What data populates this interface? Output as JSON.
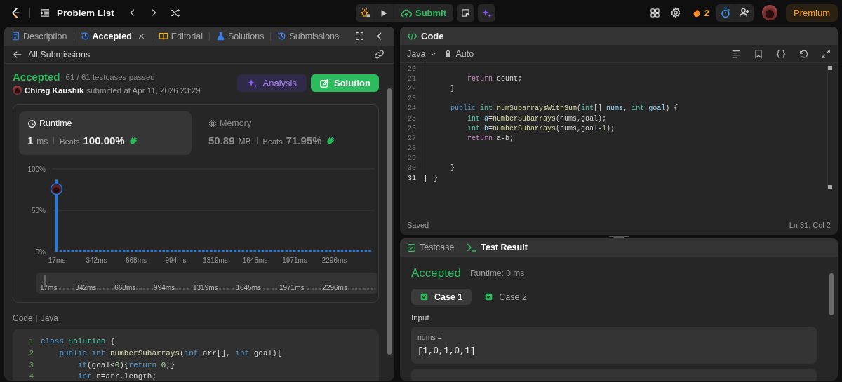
{
  "topbar": {
    "problem_list": "Problem List",
    "submit": "Submit",
    "streak": "2",
    "premium": "Premium"
  },
  "tabs": [
    {
      "label": "Description",
      "kind": "description",
      "selected": false,
      "closable": false
    },
    {
      "label": "Accepted",
      "kind": "result",
      "selected": true,
      "closable": true
    },
    {
      "label": "Editorial",
      "kind": "editorial",
      "selected": false,
      "closable": false
    },
    {
      "label": "Solutions",
      "kind": "solutions",
      "selected": false,
      "closable": false
    },
    {
      "label": "Submissions",
      "kind": "submissions",
      "selected": false,
      "closable": false
    }
  ],
  "submission": {
    "back": "All Submissions",
    "status": "Accepted",
    "passed": "61 / 61 testcases passed",
    "author": "Chirag Kaushik",
    "submitted": "submitted at Apr 11, 2026 23:29",
    "buttons": [
      {
        "label": "Analysis",
        "kind": "analysis"
      },
      {
        "label": "Solution",
        "kind": "solution"
      }
    ]
  },
  "metrics": [
    {
      "kind": "runtime",
      "label": "Runtime",
      "value": "1",
      "unit": "ms",
      "beats_label": "Beats",
      "beats": "100.00%",
      "selected": true
    },
    {
      "kind": "memory",
      "label": "Memory",
      "value": "50.89",
      "unit": "MB",
      "beats_label": "Beats",
      "beats": "71.95%",
      "selected": false
    }
  ],
  "chart_data": {
    "type": "bar",
    "ylim": [
      0,
      100
    ],
    "yticks": [
      {
        "value": 0,
        "label": "0%"
      },
      {
        "value": 50,
        "label": "50%"
      },
      {
        "value": 100,
        "label": "100%"
      }
    ],
    "categories": [
      "17ms",
      null,
      null,
      null,
      null,
      null,
      null,
      null,
      null,
      null,
      "342ms",
      null,
      null,
      null,
      null,
      null,
      null,
      null,
      null,
      null,
      "668ms",
      null,
      null,
      null,
      null,
      null,
      null,
      null,
      null,
      null,
      "994ms",
      null,
      null,
      null,
      null,
      null,
      null,
      null,
      null,
      null,
      "1319ms",
      null,
      null,
      null,
      null,
      null,
      null,
      null,
      null,
      null,
      "1645ms",
      null,
      null,
      null,
      null,
      null,
      null,
      null,
      null,
      null,
      "1971ms",
      null,
      null,
      null,
      null,
      null,
      null,
      null,
      null,
      null,
      "2296ms",
      null,
      null,
      null,
      null,
      null,
      null,
      null,
      null,
      null
    ],
    "values": [
      87,
      2,
      2,
      2,
      2,
      2,
      2,
      2,
      2,
      2,
      2,
      2,
      2,
      2,
      2,
      2,
      2,
      2,
      2,
      2,
      2,
      2,
      2,
      2,
      2,
      2,
      2,
      2,
      2,
      2,
      2,
      2,
      2,
      2,
      2,
      2,
      2,
      2,
      2,
      2,
      2,
      2,
      2,
      2,
      2,
      2,
      2,
      2,
      2,
      2,
      2,
      2,
      2,
      2,
      2,
      2,
      2,
      2,
      2,
      2,
      2,
      2,
      2,
      2,
      2,
      2,
      2,
      2,
      2,
      2,
      2,
      2,
      2,
      2,
      2,
      2,
      2,
      2,
      2,
      2
    ]
  },
  "navigator_labels": [
    "17ms",
    "342ms",
    "668ms",
    "994ms",
    "1319ms",
    "1645ms",
    "1971ms",
    "2296ms"
  ],
  "code_section": {
    "label": "Code",
    "language": "Java",
    "lines": [
      {
        "number": "1",
        "tokens": [
          {
            "kind": "kw",
            "text": "class"
          },
          {
            "kind": "type",
            "text": " Solution"
          },
          {
            "kind": "plain",
            "text": " {"
          }
        ]
      },
      {
        "number": "2",
        "tokens": [
          {
            "kind": "kw",
            "text": "    public"
          },
          {
            "kind": "kw",
            "text": " int"
          },
          {
            "kind": "fn",
            "text": " numberSubarrays"
          },
          {
            "kind": "plain",
            "text": "("
          },
          {
            "kind": "kw",
            "text": "int"
          },
          {
            "kind": "plain",
            "text": " arr[], "
          },
          {
            "kind": "kw",
            "text": "int"
          },
          {
            "kind": "plain",
            "text": " goal){"
          }
        ]
      },
      {
        "number": "3",
        "tokens": [
          {
            "kind": "kw",
            "text": "        if"
          },
          {
            "kind": "plain",
            "text": "(goal<"
          },
          {
            "kind": "num",
            "text": "0"
          },
          {
            "kind": "plain",
            "text": "){"
          },
          {
            "kind": "kw",
            "text": "return"
          },
          {
            "kind": "num",
            "text": " 0"
          },
          {
            "kind": "plain",
            "text": ";}"
          }
        ]
      },
      {
        "number": "4",
        "tokens": [
          {
            "kind": "kw",
            "text": "        int"
          },
          {
            "kind": "plain",
            "text": " n=arr.length;"
          }
        ]
      }
    ]
  },
  "editor": {
    "title": "Code",
    "language": "Java",
    "mode": "Auto",
    "status": "Saved",
    "cursor": "Ln 31, Col 2",
    "lines": [
      {
        "number": "20",
        "active": false
      },
      {
        "number": "21",
        "active": false,
        "tokens": [
          {
            "kind": "ctrl",
            "text": "        return"
          },
          {
            "kind": "plain",
            "text": " count;"
          }
        ]
      },
      {
        "number": "22",
        "active": false,
        "tokens": [
          {
            "kind": "plain",
            "text": "    }"
          }
        ]
      },
      {
        "number": "23",
        "active": false
      },
      {
        "number": "24",
        "active": false,
        "tokens": [
          {
            "kind": "kw",
            "text": "    public"
          },
          {
            "kind": "type",
            "text": " int"
          },
          {
            "kind": "fn",
            "text": " numSubarraysWithSum"
          },
          {
            "kind": "plain",
            "text": "("
          },
          {
            "kind": "type",
            "text": "int"
          },
          {
            "kind": "plain",
            "text": "[] "
          },
          {
            "kind": "var",
            "text": "nums"
          },
          {
            "kind": "plain",
            "text": ", "
          },
          {
            "kind": "type",
            "text": "int"
          },
          {
            "kind": "var",
            "text": " goal"
          },
          {
            "kind": "plain",
            "text": ") {"
          }
        ]
      },
      {
        "number": "25",
        "active": false,
        "tokens": [
          {
            "kind": "type",
            "text": "        int"
          },
          {
            "kind": "var",
            "text": " a"
          },
          {
            "kind": "plain",
            "text": "="
          },
          {
            "kind": "fn",
            "text": "numberSubarrays"
          },
          {
            "kind": "plain",
            "text": "(nums,goal);"
          }
        ]
      },
      {
        "number": "26",
        "active": false,
        "tokens": [
          {
            "kind": "type",
            "text": "        int"
          },
          {
            "kind": "var",
            "text": " b"
          },
          {
            "kind": "plain",
            "text": "="
          },
          {
            "kind": "fn",
            "text": "numberSubarrays"
          },
          {
            "kind": "plain",
            "text": "(nums,goal-"
          },
          {
            "kind": "num",
            "text": "1"
          },
          {
            "kind": "plain",
            "text": ");"
          }
        ]
      },
      {
        "number": "27",
        "active": false,
        "tokens": [
          {
            "kind": "ctrl",
            "text": "        return"
          },
          {
            "kind": "plain",
            "text": " a-b;"
          }
        ]
      },
      {
        "number": "28",
        "active": false
      },
      {
        "number": "29",
        "active": false
      },
      {
        "number": "30",
        "active": false,
        "tokens": [
          {
            "kind": "plain",
            "text": "    }"
          }
        ]
      },
      {
        "number": "31",
        "active": true,
        "tokens": [
          {
            "kind": "plain",
            "text": "}"
          }
        ]
      }
    ]
  },
  "tests": {
    "tabs": [
      {
        "label": "Testcase",
        "kind": "testcase",
        "selected": false
      },
      {
        "label": "Test Result",
        "kind": "result",
        "selected": true
      }
    ],
    "status": "Accepted",
    "runtime": "Runtime: 0 ms",
    "cases": [
      {
        "label": "Case 1",
        "selected": true,
        "passed": true
      },
      {
        "label": "Case 2",
        "selected": false,
        "passed": true
      }
    ],
    "input_label": "Input",
    "inputs": [
      {
        "name": "nums =",
        "value": "[1,0,1,0,1]"
      }
    ]
  }
}
